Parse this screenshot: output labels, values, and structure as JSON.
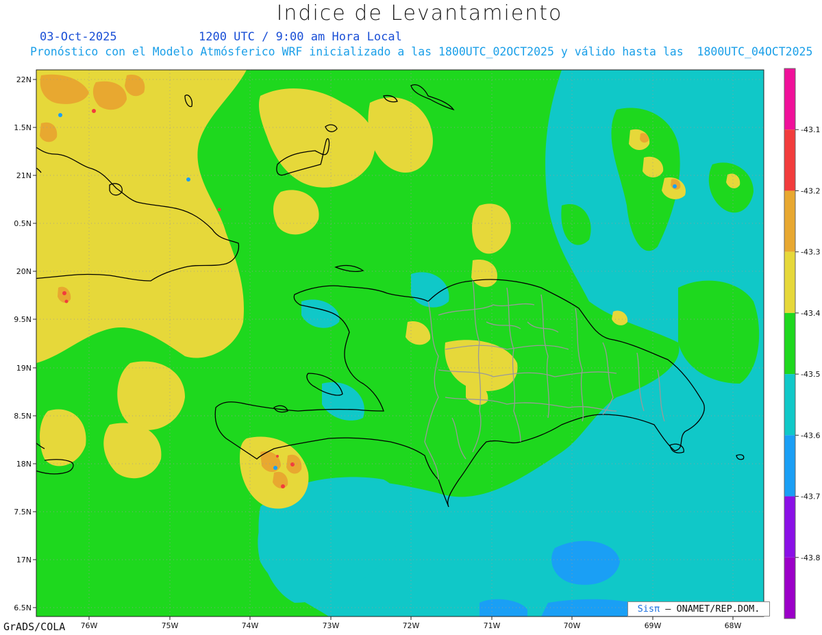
{
  "title": "Indice de Levantamiento",
  "date": "03-Oct-2025",
  "time": "1200 UTC / 9:00 am Hora Local",
  "subtitle": "Pronóstico con el Modelo Atmósferico WRF inicializado a las 1800UTC_02OCT2025 y válido hasta las  1800UTC_04OCT2025",
  "footer": "GrADS/COLA",
  "credit": {
    "sis": "Sisπ",
    "rest": "– ONAMET/REP.DOM."
  },
  "lat_labels": [
    "22N",
    "1.5N",
    "21N",
    "0.5N",
    "20N",
    "9.5N",
    "19N",
    "8.5N",
    "18N",
    "7.5N",
    "17N",
    "6.5N"
  ],
  "lon_labels": [
    "76W",
    "75W",
    "74W",
    "73W",
    "72W",
    "71W",
    "70W",
    "69W",
    "68W"
  ],
  "colorbar": {
    "colors": [
      "#f0109a",
      "#f23c3c",
      "#e8a830",
      "#e6d83a",
      "#1ed81e",
      "#10c8c8",
      "#1a9ff5",
      "#8a10e6",
      "#9b00c8"
    ],
    "labels": [
      "-43.1",
      "-43.2",
      "-43.3",
      "-43.4",
      "-43.5",
      "-43.6",
      "-43.7",
      "-43.8"
    ]
  },
  "palette": {
    "yellow": "#e6d83a",
    "green": "#1ed81e",
    "cyan": "#10c8c8",
    "blue": "#1a9ff5",
    "orange": "#e8a830",
    "red": "#f23c3c"
  }
}
